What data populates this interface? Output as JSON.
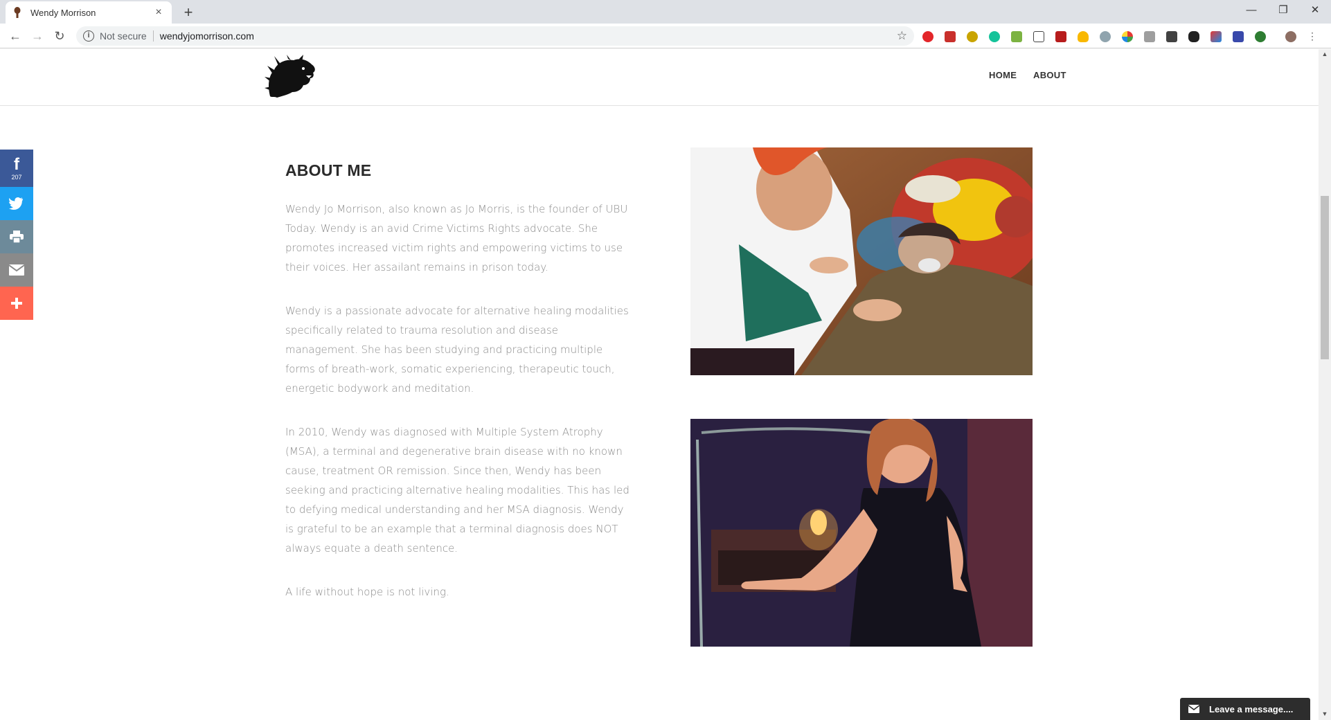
{
  "browser": {
    "tab_title": "Wendy Morrison",
    "tab_close": "×",
    "new_tab": "+",
    "not_secure": "Not secure",
    "url": "wendyjomorrison.com",
    "minimize": "—",
    "restore": "❐",
    "close": "✕",
    "back": "←",
    "forward": "→",
    "reload": "↻",
    "bookmark_star": "☆"
  },
  "header": {
    "nav": [
      "HOME",
      "ABOUT"
    ]
  },
  "content": {
    "heading": "ABOUT ME",
    "paragraphs": [
      "Wendy Jo Morrison, also known as Jo Morris, is the founder of UBU Today. Wendy is an avid Crime Victims Rights advocate. She promotes increased victim rights and empowering victims to use their voices. Her assailant remains in prison today.",
      "Wendy is a passionate advocate for alternative healing modalities specifically related to trauma resolution and disease management. She has been studying and practicing multiple forms of breath-work, somatic experiencing, therapeutic touch, energetic bodywork and meditation.",
      "In 2010, Wendy was diagnosed with Multiple System Atrophy (MSA), a terminal and degenerative brain disease with no known cause, treatment OR remission. Since then, Wendy has been seeking and practicing alternative healing modalities. This has led to defying medical understanding and her MSA diagnosis. Wendy is grateful to be an example that a terminal diagnosis does NOT always equate a death sentence.",
      "A life without hope is not living."
    ]
  },
  "share": {
    "facebook_count": "207",
    "icons": [
      "facebook-icon",
      "twitter-icon",
      "print-icon",
      "email-icon",
      "plus-icon"
    ],
    "colors": {
      "facebook": "#3b5998",
      "twitter": "#1da1f2",
      "print": "#6d8a9a",
      "email": "#8a8a8a",
      "more": "#ff6550"
    }
  },
  "chat": {
    "label": "Leave a message...."
  }
}
